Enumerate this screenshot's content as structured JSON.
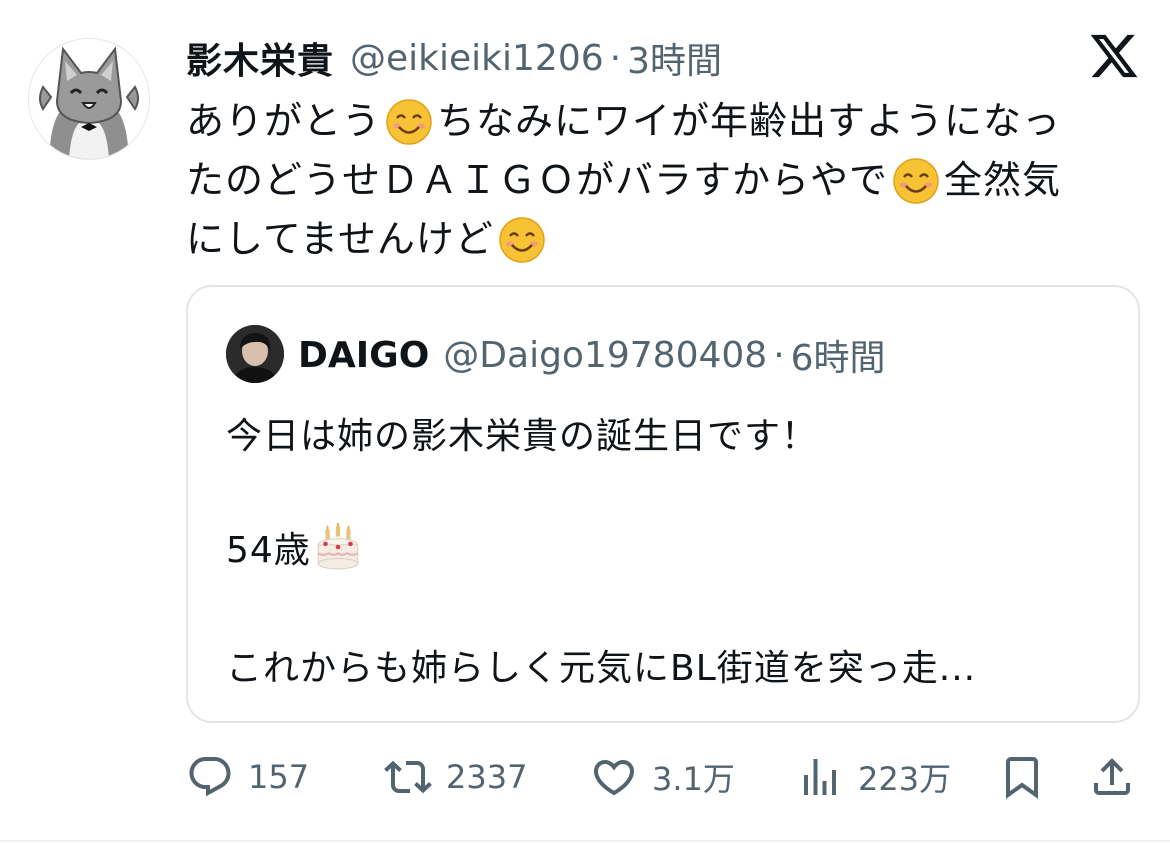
{
  "tweet": {
    "author_name": "影木栄貴",
    "handle": "@eikieiki1206",
    "separator": "·",
    "time": "3時間",
    "lines": [
      {
        "a": "ありがとう",
        "b": "ちなみにワイが年齢出すようになっ"
      },
      {
        "a": "たのどうせＤＡＩＧＯがバラすからやで",
        "b": "全然気"
      },
      {
        "a": "にしてませんけど",
        "b": ""
      }
    ],
    "emoji": "smiling-face-icon"
  },
  "quote": {
    "author_name": "DAIGO",
    "handle": "@Daigo19780408",
    "separator": "·",
    "time": "6時間",
    "line1": "今日は姉の影木栄貴の誕生日です！",
    "line2": "54歳",
    "line2_emoji": "birthday-cake-icon",
    "line3": "これからも姉らしく元気にBL街道を突っ走..."
  },
  "actions": {
    "replies": "157",
    "retweets": "2337",
    "likes": "3.1万",
    "views": "223万"
  },
  "colors": {
    "text": "#0f1419",
    "secondary": "#536471",
    "border": "#e1e6ea",
    "emoji": "#f7c233"
  }
}
